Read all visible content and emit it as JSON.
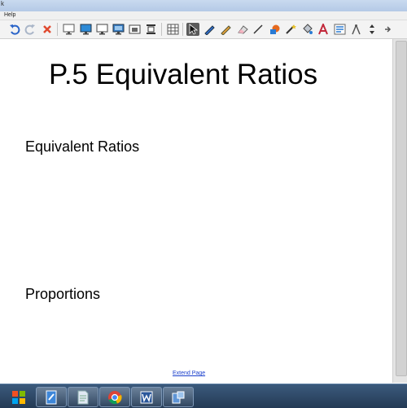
{
  "window": {
    "title_fragment": "k"
  },
  "menubar": {
    "items": [
      "Help"
    ]
  },
  "toolbar": {
    "tools": [
      "undo-icon",
      "redo-icon",
      "delete-icon",
      "screen-shade-icon",
      "display-icon",
      "monitor-icon",
      "monitor-alt-icon",
      "camera-icon",
      "capture-icon",
      "table-icon",
      "select-arrow-icon",
      "pen-icon",
      "creative-pen-icon",
      "eraser-icon",
      "line-icon",
      "shapes-icon",
      "magic-pen-icon",
      "fill-icon",
      "text-icon",
      "properties-icon",
      "measure-icon",
      "move-toolbar-icon",
      "more-icon"
    ],
    "selected": "select-arrow-icon"
  },
  "page": {
    "title": "P.5 Equivalent Ratios",
    "heading1": "Equivalent Ratios",
    "heading2": "Proportions",
    "extend_link": "Extend Page"
  },
  "taskbar": {
    "apps": [
      "start-icon",
      "notebook-icon",
      "file-icon",
      "chrome-icon",
      "word-icon",
      "smart-icon"
    ]
  },
  "colors": {
    "accent": "#1a3fcc",
    "taskbar": "#2e4a6b"
  }
}
